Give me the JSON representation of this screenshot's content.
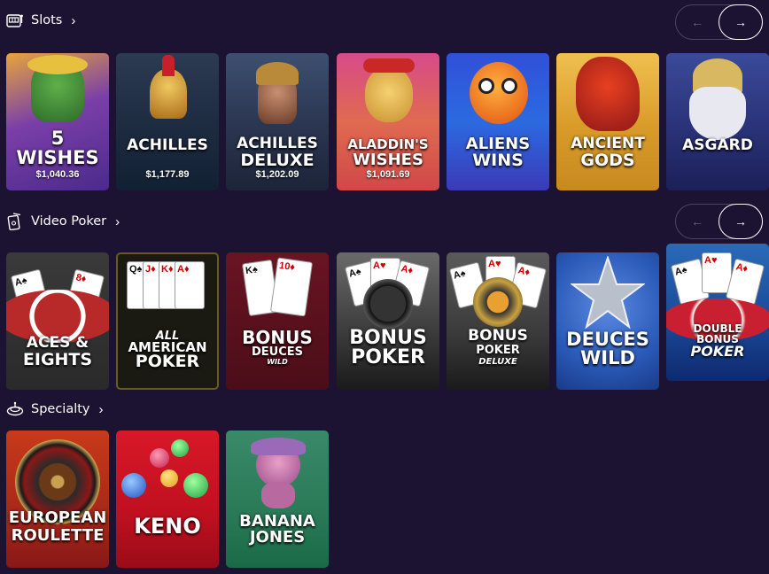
{
  "sections": {
    "slots": {
      "title": "Slots",
      "games": [
        {
          "title": "5 WISHES",
          "jackpot": "$1,040.36"
        },
        {
          "title": "ACHILLES",
          "jackpot": "$1,177.89"
        },
        {
          "title": "ACHILLES DELUXE",
          "jackpot": "$1,202.09"
        },
        {
          "title": "ALADDIN'S WISHES",
          "jackpot": "$1,091.69"
        },
        {
          "title": "ALIENS WINS"
        },
        {
          "title": "ANCIENT GODS"
        },
        {
          "title": "ASGARD"
        }
      ]
    },
    "video_poker": {
      "title": "Video Poker",
      "games": [
        {
          "title": "ACES & EIGHTS"
        },
        {
          "title": "ALL AMERICAN POKER"
        },
        {
          "title": "BONUS DEUCES WILD"
        },
        {
          "title": "BONUS POKER"
        },
        {
          "title": "BONUS POKER DELUXE"
        },
        {
          "title": "DEUCES WILD"
        },
        {
          "title": "DOUBLE BONUS POKER"
        }
      ]
    },
    "specialty": {
      "title": "Specialty",
      "games": [
        {
          "title": "EUROPEAN ROULETTE"
        },
        {
          "title": "KENO"
        },
        {
          "title": "BANANA JONES"
        }
      ]
    }
  },
  "tile_text": {
    "t1a": "5",
    "t1b": "WISHES",
    "t2a": "ACHILLES",
    "t3a": "ACHILLES",
    "t3b": "DELUXE",
    "t4a": "ALADDIN'S",
    "t4b": "WISHES",
    "t5a": "ALIENS",
    "t5b": "WINS",
    "t6a": "ANCIENT",
    "t6b": "GODS",
    "t7a": "ASGARD",
    "v1a": "ACES &",
    "v1b": "EIGHTS",
    "v2a": "ALL",
    "v2b": "AMERICAN",
    "v2c": "POKER",
    "v3a": "BONUS",
    "v3b": "DEUCES",
    "v3c": "WILD",
    "v4a": "BONUS",
    "v4b": "POKER",
    "v5a": "BONUS",
    "v5b": "POKER",
    "v5c": "DELUXE",
    "v6a": "DEUCES",
    "v6b": "WILD",
    "v7a": "DOUBLE",
    "v7b": "BONUS",
    "v7c": "POKER",
    "s1a": "EUROPEAN",
    "s1b": "ROULETTE",
    "s2a": "KENO",
    "s3a": "BANANA",
    "s3b": "JONES"
  },
  "nav": {
    "prev_icon": "arrow-left-icon",
    "next_icon": "arrow-right-icon",
    "prev": "←",
    "next": "→",
    "chevron": "›"
  },
  "colors": {
    "background": "#1c1232",
    "nav_border": "#4a4360"
  }
}
